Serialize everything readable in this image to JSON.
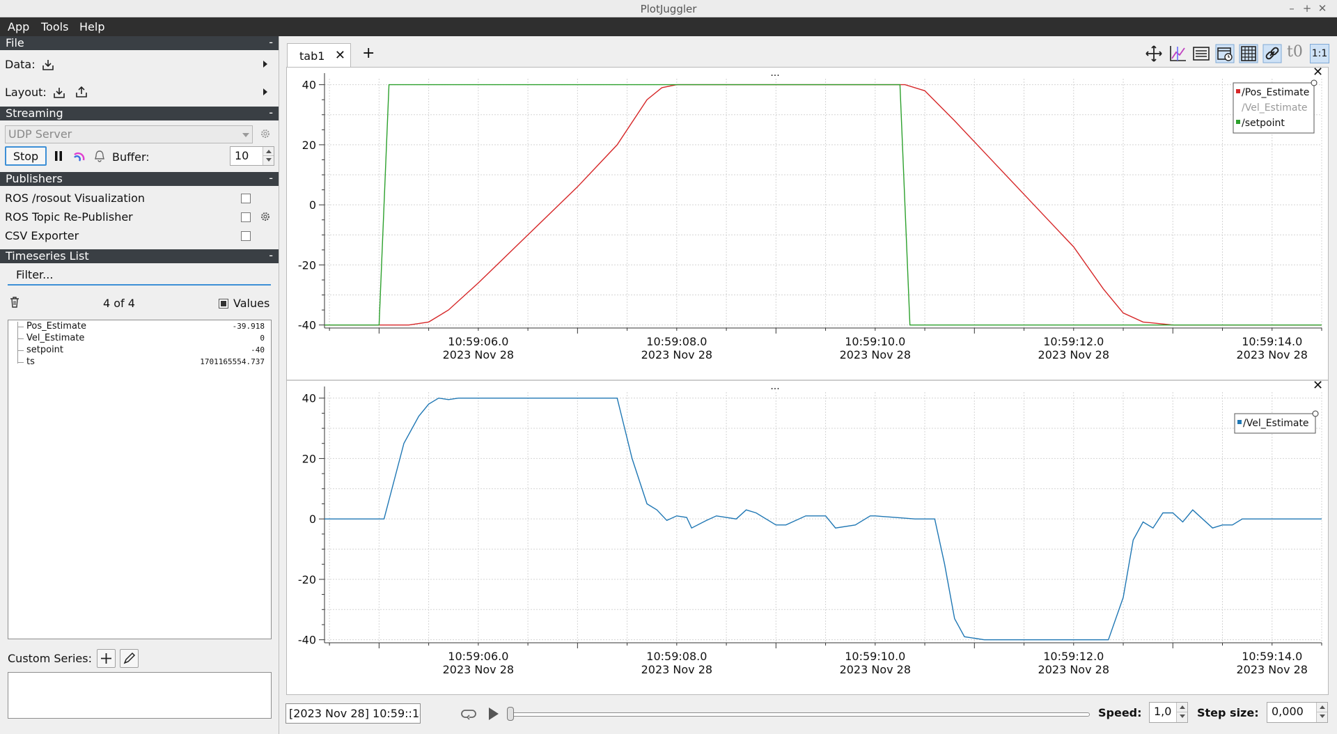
{
  "window": {
    "title": "PlotJuggler",
    "controls": [
      "–",
      "+",
      "✕"
    ]
  },
  "menu": [
    "App",
    "Tools",
    "Help"
  ],
  "sections": {
    "file": "File",
    "streaming": "Streaming",
    "publishers": "Publishers",
    "timeseries": "Timeseries List",
    "collapse": "-"
  },
  "file": {
    "data_label": "Data:",
    "layout_label": "Layout:"
  },
  "streaming": {
    "source": "UDP Server",
    "stop_label": "Stop",
    "buffer_label": "Buffer:",
    "buffer_value": "10"
  },
  "publishers": [
    {
      "label": "ROS /rosout Visualization",
      "checked": false,
      "settings": false
    },
    {
      "label": "ROS Topic Re-Publisher",
      "checked": false,
      "settings": true
    },
    {
      "label": "CSV Exporter",
      "checked": false,
      "settings": false
    }
  ],
  "timeseries": {
    "filter_placeholder": "Filter...",
    "count": "4 of 4",
    "values_label": "Values",
    "items": [
      {
        "name": "Pos_Estimate",
        "value": "-39.918"
      },
      {
        "name": "Vel_Estimate",
        "value": "0"
      },
      {
        "name": "setpoint",
        "value": "-40"
      },
      {
        "name": "ts",
        "value": "1701165554.737"
      }
    ]
  },
  "custom_series": {
    "label": "Custom Series:"
  },
  "tabs": [
    {
      "label": "tab1"
    }
  ],
  "toolbar_icons": [
    "move-icon",
    "axis-icon",
    "list-icon",
    "time-calendar-icon",
    "grid-icon",
    "link-icon",
    "t0-icon",
    "ratio-1-1-icon"
  ],
  "toolbar_text": {
    "t0": "t0",
    "ratio": "1:1"
  },
  "plot_title": "...",
  "x_ticks": [
    {
      "time": "10:59:06.0",
      "date": "2023 Nov 28",
      "t": 6
    },
    {
      "time": "10:59:08.0",
      "date": "2023 Nov 28",
      "t": 8
    },
    {
      "time": "10:59:10.0",
      "date": "2023 Nov 28",
      "t": 10
    },
    {
      "time": "10:59:12.0",
      "date": "2023 Nov 28",
      "t": 12
    },
    {
      "time": "10:59:14.0",
      "date": "2023 Nov 28",
      "t": 14
    }
  ],
  "chart_data": [
    {
      "type": "line",
      "title": "...",
      "xlim": [
        4.45,
        14.5
      ],
      "ylim": [
        -41,
        42
      ],
      "y_ticks": [
        40,
        20,
        0,
        -20,
        -40
      ],
      "grid": true,
      "legend": "top-right",
      "series": [
        {
          "name": "/Pos_Estimate",
          "color": "#d62728",
          "visible": true,
          "x": [
            4.45,
            5.0,
            5.3,
            5.5,
            5.7,
            6.0,
            6.5,
            7.0,
            7.4,
            7.7,
            7.85,
            8.0,
            9.0,
            10.0,
            10.3,
            10.5,
            10.8,
            11.2,
            11.6,
            12.0,
            12.3,
            12.5,
            12.7,
            13.0,
            14.0,
            14.5
          ],
          "y": [
            -40,
            -40,
            -40,
            -39,
            -35,
            -26,
            -10,
            6,
            20,
            35,
            39,
            40,
            40,
            40,
            40,
            38,
            28,
            14,
            0,
            -14,
            -28,
            -36,
            -39,
            -40,
            -40,
            -40
          ]
        },
        {
          "name": "/Vel_Estimate",
          "color": "#1f77b4",
          "visible": false,
          "x": [],
          "y": []
        },
        {
          "name": "/setpoint",
          "color": "#2ca02c",
          "visible": true,
          "x": [
            4.45,
            5.0,
            5.1,
            10.25,
            10.35,
            14.5
          ],
          "y": [
            -40,
            -40,
            40,
            40,
            -40,
            -40
          ]
        }
      ]
    },
    {
      "type": "line",
      "title": "...",
      "xlim": [
        4.45,
        14.5
      ],
      "ylim": [
        -41,
        42
      ],
      "y_ticks": [
        40,
        20,
        0,
        -20,
        -40
      ],
      "grid": true,
      "legend": "top-right",
      "series": [
        {
          "name": "/Vel_Estimate",
          "color": "#1f77b4",
          "visible": true,
          "x": [
            4.45,
            5.05,
            5.25,
            5.4,
            5.5,
            5.6,
            5.7,
            5.8,
            6.0,
            7.0,
            7.4,
            7.55,
            7.7,
            7.8,
            7.9,
            8.0,
            8.1,
            8.15,
            8.3,
            8.4,
            8.6,
            8.7,
            8.8,
            9.0,
            9.1,
            9.3,
            9.5,
            9.6,
            9.8,
            9.95,
            10.0,
            10.4,
            10.6,
            10.7,
            10.8,
            10.9,
            11.0,
            11.1,
            12.0,
            12.35,
            12.5,
            12.6,
            12.7,
            12.8,
            12.9,
            13.0,
            13.1,
            13.2,
            13.3,
            13.4,
            13.5,
            13.6,
            13.7,
            13.8,
            13.9,
            14.0,
            14.5
          ],
          "y": [
            0,
            0,
            25,
            34,
            38,
            40,
            39.5,
            40,
            40,
            40,
            40,
            20,
            5,
            3,
            -0.5,
            1,
            0.5,
            -3,
            -0.5,
            1,
            0,
            3,
            2,
            -2,
            -2,
            1,
            1,
            -3,
            -2,
            1,
            1,
            0,
            0,
            -15,
            -33,
            -39,
            -39.5,
            -40,
            -40,
            -40,
            -26,
            -7,
            -1,
            -3,
            2,
            2,
            -1,
            3,
            0,
            -3,
            -2,
            -2,
            0,
            0,
            0,
            0,
            0
          ]
        }
      ]
    }
  ]
}
